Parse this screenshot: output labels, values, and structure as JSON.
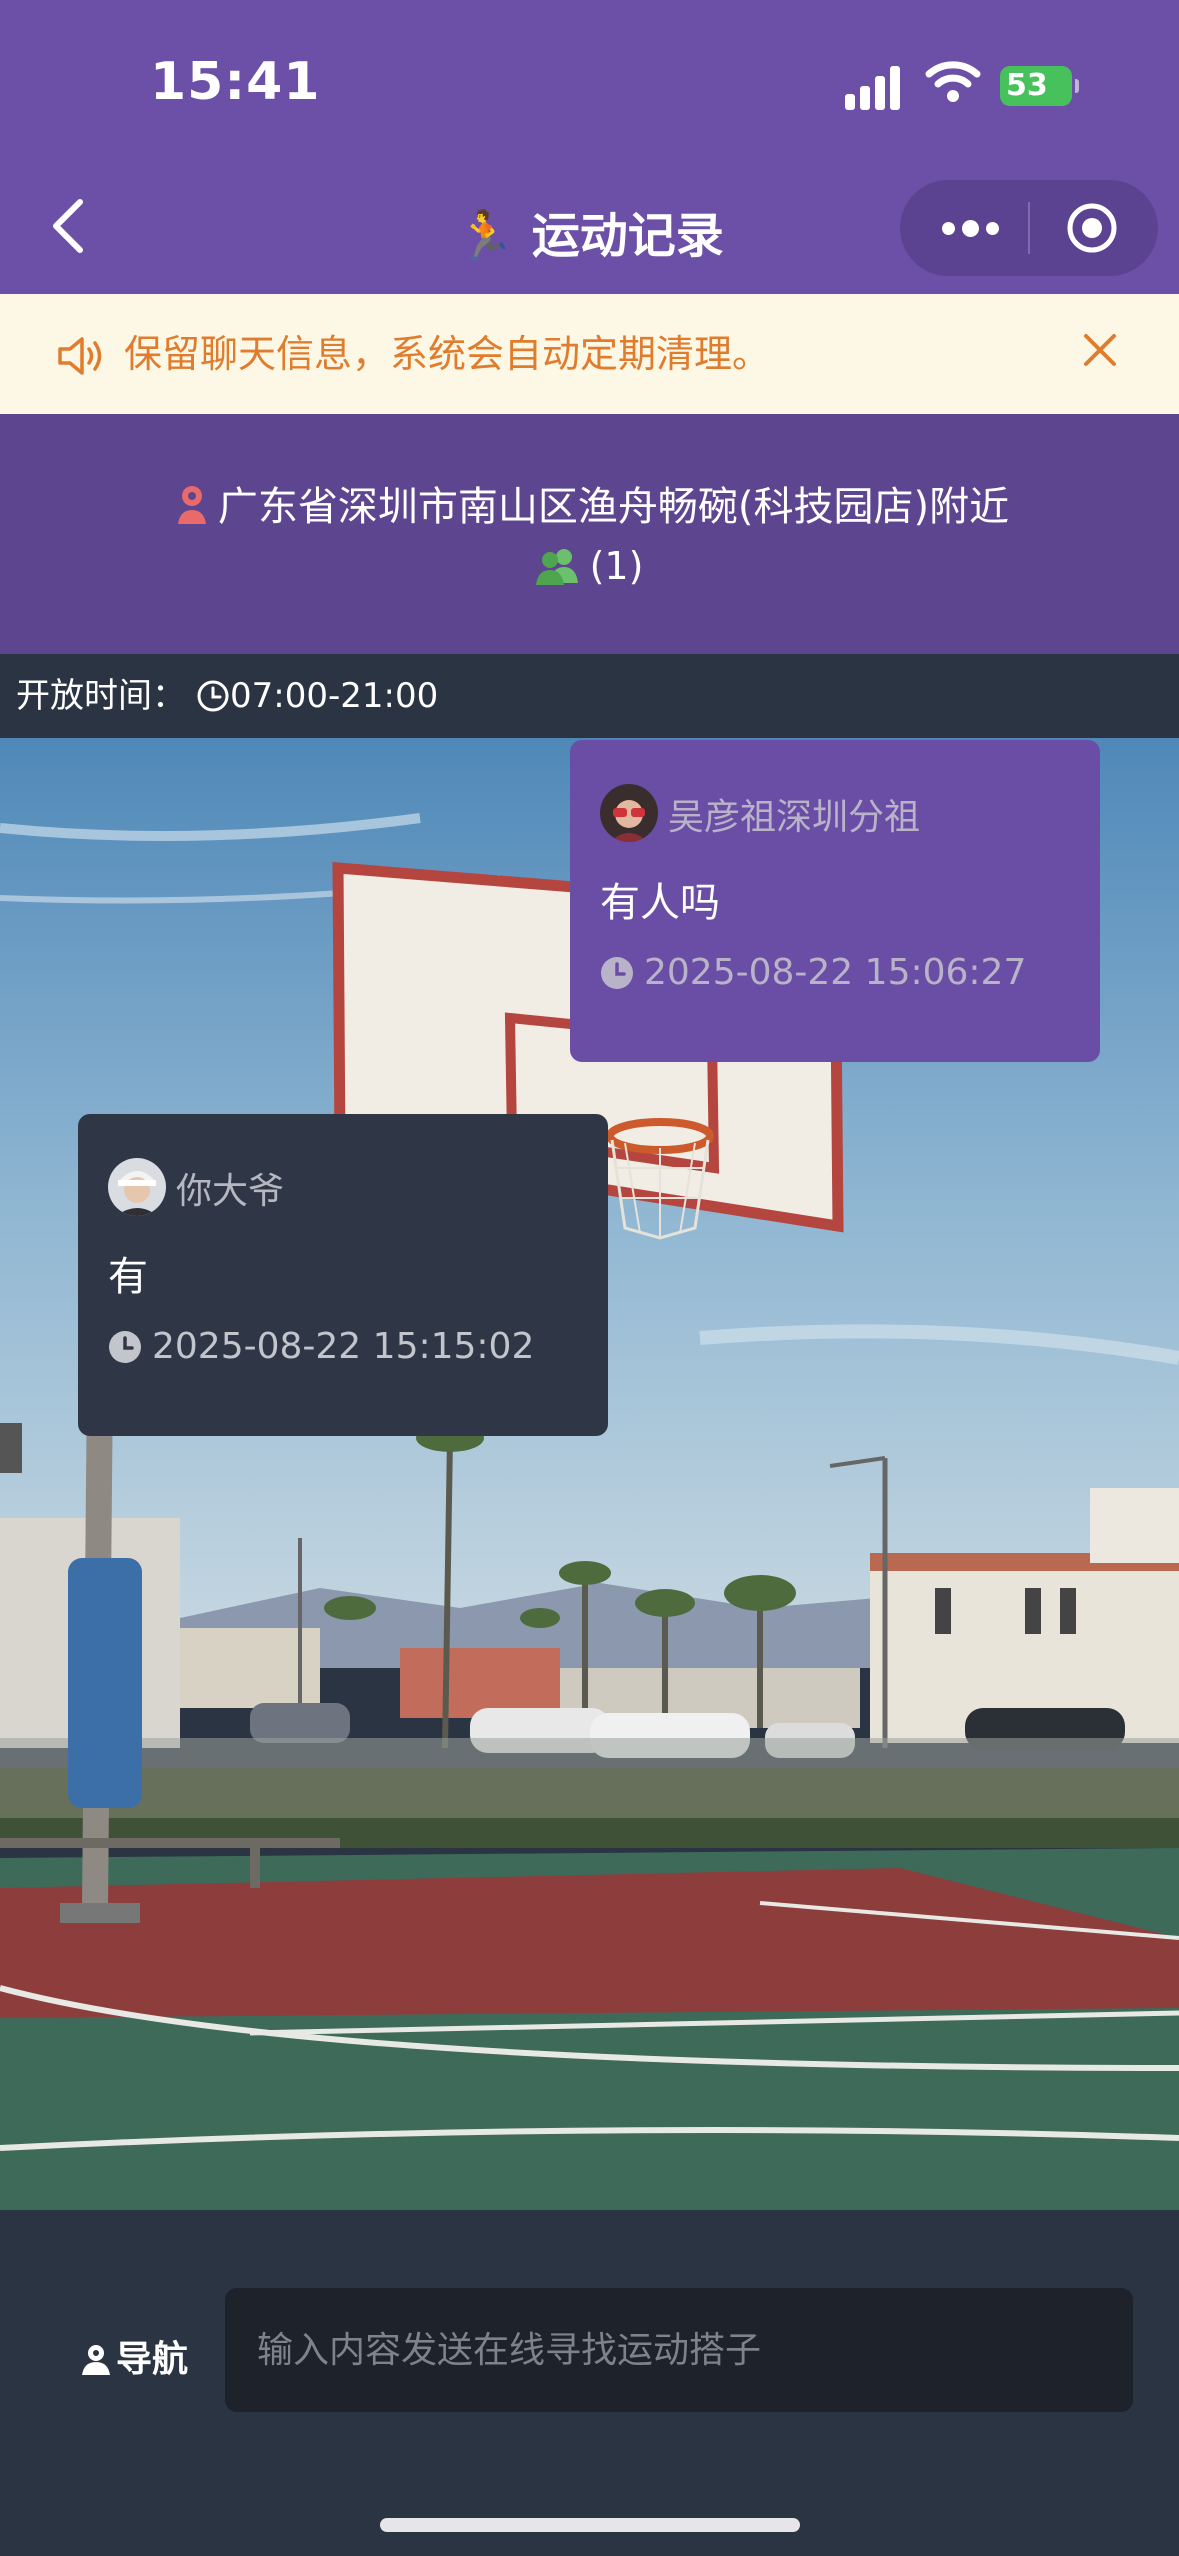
{
  "status_bar": {
    "time": "15:41",
    "battery": "53"
  },
  "header": {
    "title": "🏃 运动记录"
  },
  "notice": {
    "text": "保留聊天信息，系统会自动定期清理。"
  },
  "location": {
    "address": "广东省深圳市南山区渔舟畅碗(科技园店)附近",
    "online_count": "(1)"
  },
  "hours": {
    "label": "开放时间：",
    "value": "07:00-21:00"
  },
  "messages": [
    {
      "user": "吴彦祖深圳分祖",
      "text": "有人吗",
      "time": "2025-08-22 15:06:27"
    },
    {
      "user": "你大爷",
      "text": "有",
      "time": "2025-08-22 15:15:02"
    }
  ],
  "bottom": {
    "nav_label": "导航",
    "input_placeholder": "输入内容发送在线寻找运动搭子"
  },
  "colors": {
    "header_bg": "#6c50a8",
    "notice_text": "#e07c2d",
    "panel_bg": "#2b3443"
  }
}
